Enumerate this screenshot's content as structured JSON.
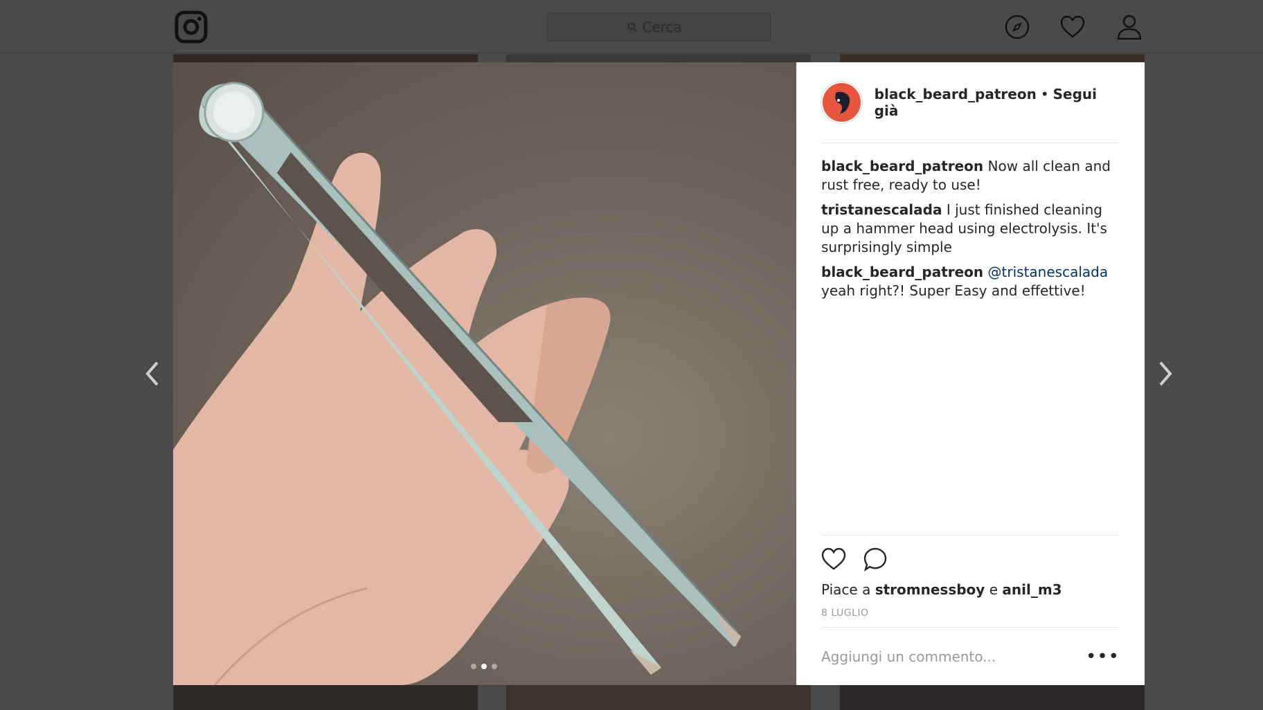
{
  "search": {
    "placeholder": "Cerca"
  },
  "post": {
    "author": "black_beard_patreon",
    "separator": "•",
    "follow_status": "Segui già",
    "carousel": {
      "count": 3,
      "active_index": 1
    },
    "comments": [
      {
        "author": "black_beard_patreon",
        "mention": "",
        "text": "Now all clean and rust free, ready to use!"
      },
      {
        "author": "tristanescalada",
        "mention": "",
        "text": "I just finished cleaning up a hammer head using electrolysis. It's surprisingly simple"
      },
      {
        "author": "black_beard_patreon",
        "mention": "@tristanescalada",
        "text": "yeah right?! Super Easy and effettive!"
      }
    ],
    "likes": {
      "prefix": "Piace a",
      "user1": "stromnessboy",
      "conj": "e",
      "user2": "anil_m3"
    },
    "date": "8 LUGLIO",
    "add_comment_placeholder": "Aggiungi un commento...",
    "more_label": "•••"
  },
  "icons": {
    "logo": "instagram-icon",
    "explore": "compass-icon",
    "activity": "heart-icon",
    "profile": "user-icon",
    "like": "heart-icon",
    "comment": "comment-icon",
    "prev": "chevron-left-icon",
    "next": "chevron-right-icon"
  },
  "colors": {
    "backdrop": "#4a4a4a",
    "avatar_bg": "#e8553f",
    "mention": "#003569",
    "text": "#262626",
    "muted": "#999999"
  }
}
